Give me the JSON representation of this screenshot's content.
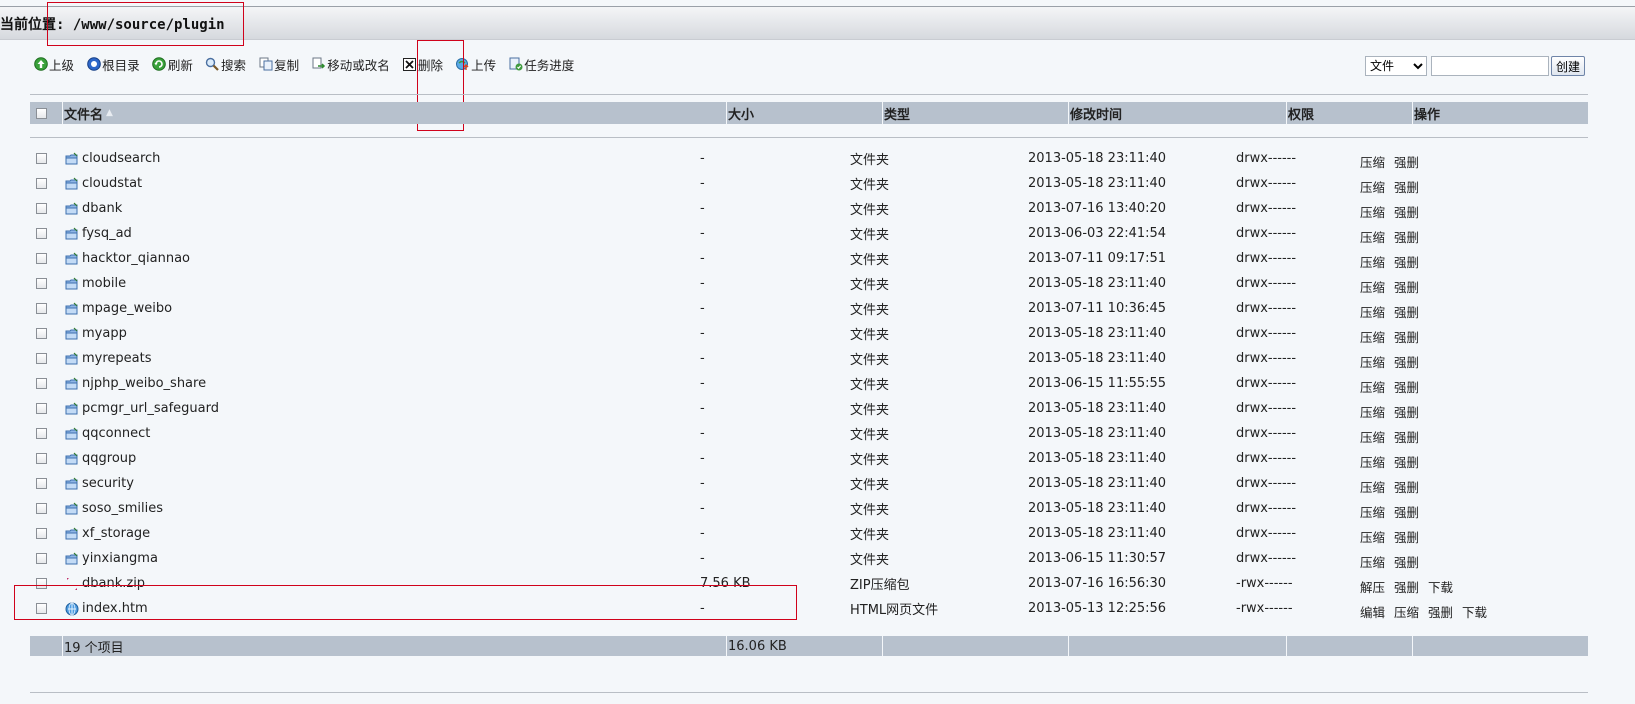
{
  "location": {
    "label": "当前位置: ",
    "path": "/www/source/plugin"
  },
  "toolbar": [
    {
      "label": "上级",
      "icon": "up-arrow-icon"
    },
    {
      "label": "根目录",
      "icon": "root-folder-icon"
    },
    {
      "label": "刷新",
      "icon": "refresh-icon"
    },
    {
      "label": "搜索",
      "icon": "search-icon"
    },
    {
      "label": "复制",
      "icon": "copy-icon"
    },
    {
      "label": "移动或改名",
      "icon": "move-icon"
    },
    {
      "label": "删除",
      "icon": "delete-icon"
    },
    {
      "label": "上传",
      "icon": "upload-icon"
    },
    {
      "label": "任务进度",
      "icon": "task-progress-icon"
    }
  ],
  "create": {
    "type_selected": "文件",
    "name_value": "",
    "button_label": "创建"
  },
  "columns": {
    "name": "文件名",
    "sort_indicator": "▲",
    "size": "大小",
    "type": "类型",
    "mtime": "修改时间",
    "perm": "权限",
    "ops": "操作"
  },
  "files": [
    {
      "name": "cloudsearch",
      "size": "-",
      "type": "文件夹",
      "mtime": "2013-05-18 23:11:40",
      "perm": "drwx------",
      "ops": [
        "压缩",
        "强删"
      ],
      "icon": "folder-icon"
    },
    {
      "name": "cloudstat",
      "size": "-",
      "type": "文件夹",
      "mtime": "2013-05-18 23:11:40",
      "perm": "drwx------",
      "ops": [
        "压缩",
        "强删"
      ],
      "icon": "folder-icon"
    },
    {
      "name": "dbank",
      "size": "-",
      "type": "文件夹",
      "mtime": "2013-07-16 13:40:20",
      "perm": "drwx------",
      "ops": [
        "压缩",
        "强删"
      ],
      "icon": "folder-icon"
    },
    {
      "name": "fysq_ad",
      "size": "-",
      "type": "文件夹",
      "mtime": "2013-06-03 22:41:54",
      "perm": "drwx------",
      "ops": [
        "压缩",
        "强删"
      ],
      "icon": "folder-icon"
    },
    {
      "name": "hacktor_qiannao",
      "size": "-",
      "type": "文件夹",
      "mtime": "2013-07-11 09:17:51",
      "perm": "drwx------",
      "ops": [
        "压缩",
        "强删"
      ],
      "icon": "folder-icon"
    },
    {
      "name": "mobile",
      "size": "-",
      "type": "文件夹",
      "mtime": "2013-05-18 23:11:40",
      "perm": "drwx------",
      "ops": [
        "压缩",
        "强删"
      ],
      "icon": "folder-icon"
    },
    {
      "name": "mpage_weibo",
      "size": "-",
      "type": "文件夹",
      "mtime": "2013-07-11 10:36:45",
      "perm": "drwx------",
      "ops": [
        "压缩",
        "强删"
      ],
      "icon": "folder-icon"
    },
    {
      "name": "myapp",
      "size": "-",
      "type": "文件夹",
      "mtime": "2013-05-18 23:11:40",
      "perm": "drwx------",
      "ops": [
        "压缩",
        "强删"
      ],
      "icon": "folder-icon"
    },
    {
      "name": "myrepeats",
      "size": "-",
      "type": "文件夹",
      "mtime": "2013-05-18 23:11:40",
      "perm": "drwx------",
      "ops": [
        "压缩",
        "强删"
      ],
      "icon": "folder-icon"
    },
    {
      "name": "njphp_weibo_share",
      "size": "-",
      "type": "文件夹",
      "mtime": "2013-06-15 11:55:55",
      "perm": "drwx------",
      "ops": [
        "压缩",
        "强删"
      ],
      "icon": "folder-icon"
    },
    {
      "name": "pcmgr_url_safeguard",
      "size": "-",
      "type": "文件夹",
      "mtime": "2013-05-18 23:11:40",
      "perm": "drwx------",
      "ops": [
        "压缩",
        "强删"
      ],
      "icon": "folder-icon"
    },
    {
      "name": "qqconnect",
      "size": "-",
      "type": "文件夹",
      "mtime": "2013-05-18 23:11:40",
      "perm": "drwx------",
      "ops": [
        "压缩",
        "强删"
      ],
      "icon": "folder-icon"
    },
    {
      "name": "qqgroup",
      "size": "-",
      "type": "文件夹",
      "mtime": "2013-05-18 23:11:40",
      "perm": "drwx------",
      "ops": [
        "压缩",
        "强删"
      ],
      "icon": "folder-icon"
    },
    {
      "name": "security",
      "size": "-",
      "type": "文件夹",
      "mtime": "2013-05-18 23:11:40",
      "perm": "drwx------",
      "ops": [
        "压缩",
        "强删"
      ],
      "icon": "folder-icon"
    },
    {
      "name": "soso_smilies",
      "size": "-",
      "type": "文件夹",
      "mtime": "2013-05-18 23:11:40",
      "perm": "drwx------",
      "ops": [
        "压缩",
        "强删"
      ],
      "icon": "folder-icon"
    },
    {
      "name": "xf_storage",
      "size": "-",
      "type": "文件夹",
      "mtime": "2013-05-18 23:11:40",
      "perm": "drwx------",
      "ops": [
        "压缩",
        "强删"
      ],
      "icon": "folder-icon"
    },
    {
      "name": "yinxiangma",
      "size": "-",
      "type": "文件夹",
      "mtime": "2013-06-15 11:30:57",
      "perm": "drwx------",
      "ops": [
        "压缩",
        "强删"
      ],
      "icon": "folder-icon"
    },
    {
      "name": "dbank.zip",
      "size": "7.56 KB",
      "type": "ZIP压缩包",
      "mtime": "2013-07-16 16:56:30",
      "perm": "-rwx------",
      "ops": [
        "解压",
        "强删",
        "下载"
      ],
      "icon": "broken-image-icon"
    },
    {
      "name": "index.htm",
      "size": "-",
      "type": "HTML网页文件",
      "mtime": "2013-05-13 12:25:56",
      "perm": "-rwx------",
      "ops": [
        "编辑",
        "压缩",
        "强删",
        "下载"
      ],
      "icon": "html-file-icon"
    }
  ],
  "footer": {
    "count": "19 个项目",
    "total_size": "16.06 KB"
  },
  "colors": {
    "header_bg": "#b7c1cd",
    "highlight_box": "#d0021b",
    "page_bg": "#f4f7fa"
  }
}
